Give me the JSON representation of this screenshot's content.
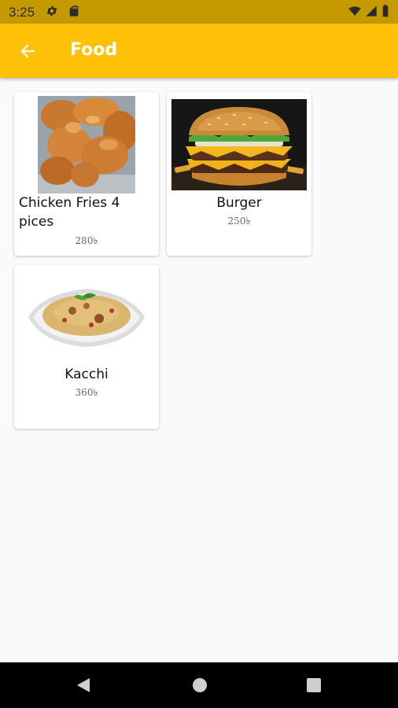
{
  "status_bar": {
    "time": "3:25"
  },
  "app_bar": {
    "title": "Food"
  },
  "items": [
    {
      "name": "Chicken Fries 4 pices",
      "price": "280৳"
    },
    {
      "name": "Burger",
      "price": "250৳"
    },
    {
      "name": "Kacchi",
      "price": "360৳"
    }
  ],
  "colors": {
    "app_bar": "#FFC107",
    "status_bar": "#C49A00",
    "background": "#FAFAFA",
    "nav_bar": "#000000"
  },
  "icons": [
    "gear-icon",
    "sd-card-icon",
    "wifi-icon",
    "cell-signal-icon",
    "battery-icon",
    "back-arrow-icon",
    "nav-back-icon",
    "nav-home-icon",
    "nav-recents-icon"
  ]
}
